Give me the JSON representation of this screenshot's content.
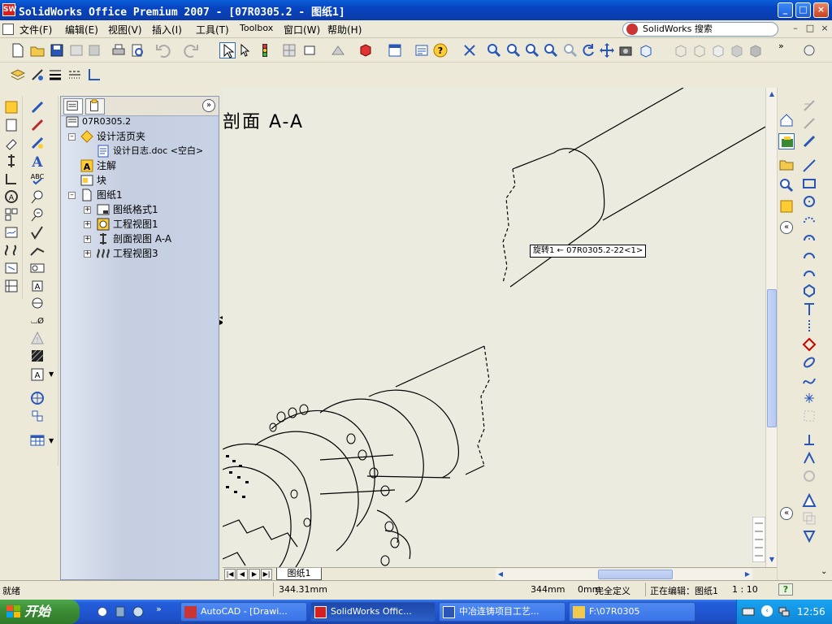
{
  "window": {
    "title": "SolidWorks Office Premium 2007 - [07R0305.2 - 图纸1]",
    "app_icon": "solidworks-icon",
    "controls": {
      "minimize": "_",
      "maximize": "□",
      "close": "×"
    }
  },
  "menu": {
    "items": [
      "文件(F)",
      "编辑(E)",
      "视图(V)",
      "插入(I)",
      "工具(T)",
      "Toolbox",
      "窗口(W)",
      "帮助(H)"
    ],
    "search_label": "SolidWorks 搜索",
    "mdi_controls": {
      "minimize": "–",
      "restore": "□",
      "close": "×"
    }
  },
  "feature_manager": {
    "tree": [
      {
        "label": "07R0305.2",
        "icon": "drawing-icon",
        "level": 0
      },
      {
        "label": "设计活页夹",
        "icon": "design-binder-icon",
        "level": 1
      },
      {
        "label": "设计日志.doc <空白>",
        "icon": "document-icon",
        "level": 2
      },
      {
        "label": "注解",
        "icon": "annotations-icon",
        "level": 1
      },
      {
        "label": "块",
        "icon": "blocks-icon",
        "level": 1
      },
      {
        "label": "图纸1",
        "icon": "sheet-icon",
        "level": 1
      },
      {
        "label": "图纸格式1",
        "icon": "sheet-format-icon",
        "level": 2
      },
      {
        "label": "工程视图1",
        "icon": "drawing-view-icon",
        "level": 2
      },
      {
        "label": "剖面视图 A-A",
        "icon": "section-view-icon",
        "level": 2
      },
      {
        "label": "工程视图3",
        "icon": "drawing-view-icon",
        "level": 2
      }
    ],
    "expand_button": "»"
  },
  "canvas": {
    "section_label": "剖面 A-A",
    "tooltip": "旋转1 ← 07R0305.2-22<1>"
  },
  "sheet_tabs": {
    "active_sheet": "图纸1",
    "nav_buttons": [
      "|◀",
      "◀",
      "▶",
      "▶|"
    ]
  },
  "status": {
    "message": "就绪",
    "x_coord": "344.31mm",
    "y_coord": "344mm",
    "z_coord": "0mm",
    "definition": "完全定义",
    "editing": "正在编辑：图纸1",
    "scale": "1 : 10",
    "help": "?"
  },
  "taskbar": {
    "start_label": "开始",
    "tasks": [
      {
        "label": "AutoCAD - [Drawi...",
        "icon": "autocad-icon",
        "active": false
      },
      {
        "label": "SolidWorks Offic...",
        "icon": "solidworks-icon",
        "active": true
      },
      {
        "label": "中冶连铸项目工艺...",
        "icon": "word-icon",
        "active": false
      },
      {
        "label": "F:\\07R0305",
        "icon": "folder-icon",
        "active": false
      }
    ],
    "clock": "12:56"
  },
  "colors": {
    "titlebar": "#0843c0",
    "canvas": "#ecebe0",
    "start_button": "#3a8a33",
    "tray": "#0f86d8"
  }
}
